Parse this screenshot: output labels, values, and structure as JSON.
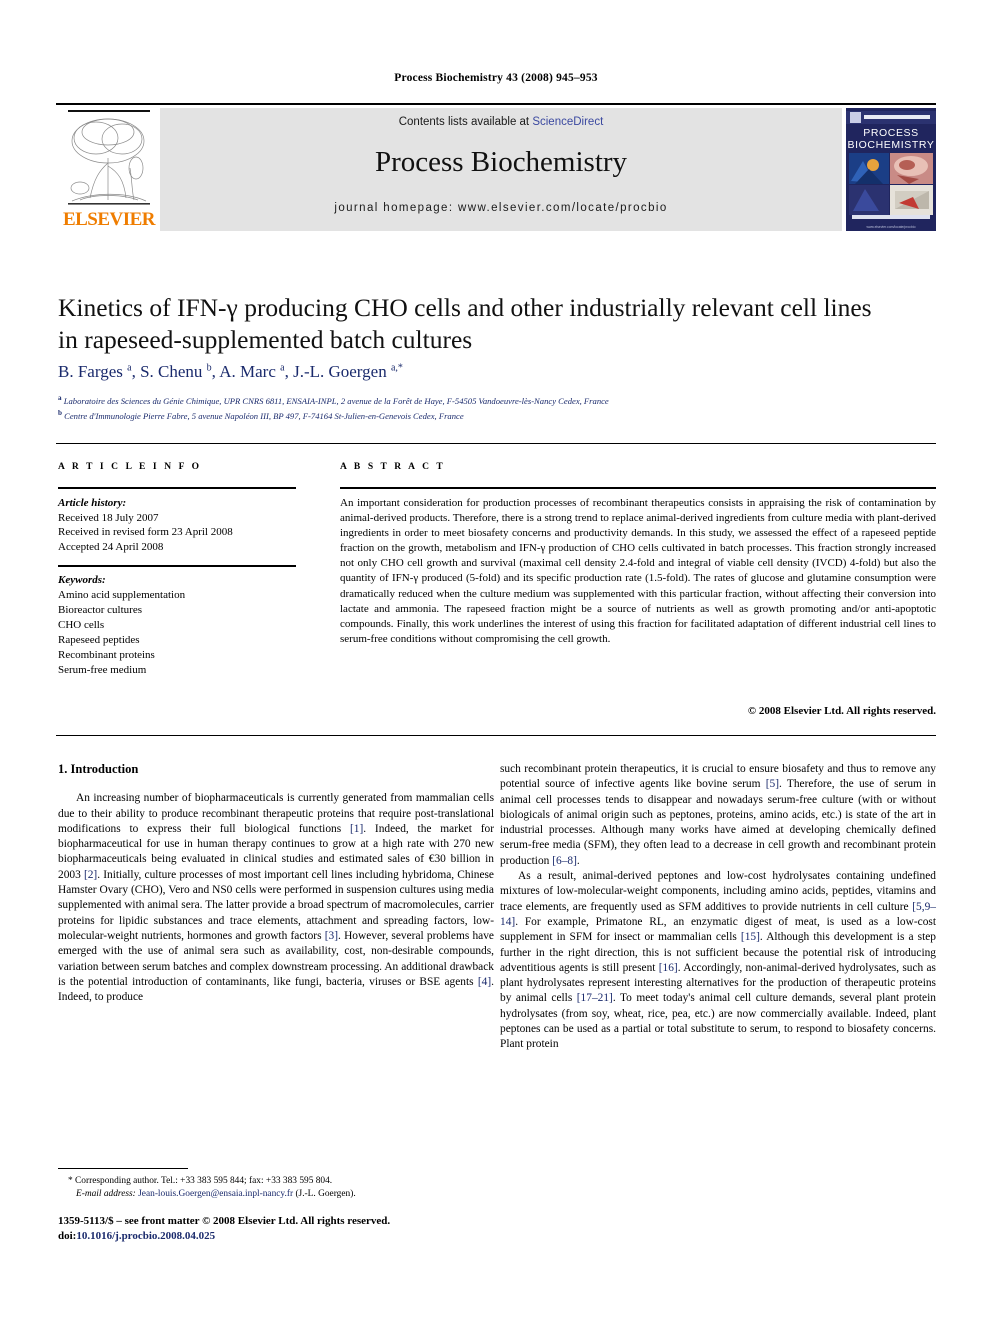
{
  "running_head": "Process Biochemistry 43 (2008) 945–953",
  "banner": {
    "contents_prefix": "Contents lists available at ",
    "sciencedirect": "ScienceDirect",
    "journal_title": "Process Biochemistry",
    "homepage": "journal homepage: www.elsevier.com/locate/procbio",
    "publisher_logo_text": "ELSEVIER",
    "cover_title_line1": "PROCESS",
    "cover_title_line2": "BIOCHEMISTRY",
    "cover_url": "www.elsevier.com/locate/procbio",
    "link_color": "#3b49a0",
    "logo_color": "#ef7d00",
    "banner_bg": "#e3e3e3",
    "cover_bg": "#20255e"
  },
  "article": {
    "title": "Kinetics of IFN-γ producing CHO cells and other industrially relevant cell lines in rapeseed-supplemented batch cultures",
    "authors_html": "B. Farges <sup>a</sup>, S. Chenu <sup>b</sup>, A. Marc <sup>a</sup>, J.-L. Goergen <sup>a,*</sup>",
    "affiliation_a": "Laboratoire des Sciences du Génie Chimique, UPR CNRS 6811, ENSAIA-INPL, 2 avenue de la Forêt de Haye, F-54505 Vandoeuvre-lès-Nancy Cedex, France",
    "affiliation_b": "Centre d'Immunologie Pierre Fabre, 5 avenue Napoléon III, BP 497, F-74164 St-Julien-en-Genevois Cedex, France",
    "author_color": "#1a2a6c"
  },
  "info": {
    "heading": "A R T I C L E   I N F O",
    "history_label": "Article history:",
    "history": [
      "Received 18 July 2007",
      "Received in revised form 23 April 2008",
      "Accepted 24 April 2008"
    ],
    "keywords_label": "Keywords:",
    "keywords": [
      "Amino acid supplementation",
      "Bioreactor cultures",
      "CHO cells",
      "Rapeseed peptides",
      "Recombinant proteins",
      "Serum-free medium"
    ]
  },
  "abstract": {
    "heading": "A B S T R A C T",
    "text": "An important consideration for production processes of recombinant therapeutics consists in appraising the risk of contamination by animal-derived products. Therefore, there is a strong trend to replace animal-derived ingredients from culture media with plant-derived ingredients in order to meet biosafety concerns and productivity demands. In this study, we assessed the effect of a rapeseed peptide fraction on the growth, metabolism and IFN-γ production of CHO cells cultivated in batch processes. This fraction strongly increased not only CHO cell growth and survival (maximal cell density 2.4-fold and integral of viable cell density (IVCD) 4-fold) but also the quantity of IFN-γ produced (5-fold) and its specific production rate (1.5-fold). The rates of glucose and glutamine consumption were dramatically reduced when the culture medium was supplemented with this particular fraction, without affecting their conversion into lactate and ammonia. The rapeseed fraction might be a source of nutrients as well as growth promoting and/or anti-apoptotic compounds. Finally, this work underlines the interest of using this fraction for facilitated adaptation of different industrial cell lines to serum-free conditions without compromising the cell growth.",
    "copyright": "© 2008 Elsevier Ltd. All rights reserved."
  },
  "body": {
    "section_heading": "1. Introduction",
    "left_paragraph_1_a": "An increasing number of biopharmaceuticals is currently generated from mammalian cells due to their ability to produce recombinant therapeutic proteins that require post-translational modifications to express their full biological functions ",
    "ref1": "[1]",
    "left_paragraph_1_b": ". Indeed, the market for biopharmaceutical for use in human therapy continues to grow at a high rate with 270 new biopharmaceuticals being evaluated in clinical studies and estimated sales of €30 billion in 2003 ",
    "ref2": "[2]",
    "left_paragraph_1_c": ". Initially, culture processes of most important cell lines including hybridoma, Chinese Hamster Ovary (CHO), Vero and NS0 cells were performed in suspension cultures using media supplemented with animal sera. The latter provide a broad spectrum of macromolecules, carrier proteins for lipidic substances and trace elements, attachment and spreading factors, low-molecular-weight nutrients, hormones and growth factors ",
    "ref3": "[3]",
    "left_paragraph_1_d": ". However, several problems have emerged with the use of animal sera such as availability, cost, non-desirable compounds, variation between serum batches and complex downstream processing. An additional drawback is the potential introduction of contaminants, like fungi, bacteria, viruses or BSE agents ",
    "ref4": "[4]",
    "left_paragraph_1_e": ". Indeed, to produce",
    "right_paragraph_1_a": "such recombinant protein therapeutics, it is crucial to ensure biosafety and thus to remove any potential source of infective agents like bovine serum ",
    "ref5": "[5]",
    "right_paragraph_1_b": ". Therefore, the use of serum in animal cell processes tends to disappear and nowadays serum-free culture (with or without biologicals of animal origin such as peptones, proteins, amino acids, etc.) is state of the art in industrial processes. Although many works have aimed at developing chemically defined serum-free media (SFM), they often lead to a decrease in cell growth and recombinant protein production ",
    "ref68": "[6–8]",
    "right_paragraph_1_c": ".",
    "right_paragraph_2_a": "As a result, animal-derived peptones and low-cost hydrolysates containing undefined mixtures of low-molecular-weight components, including amino acids, peptides, vitamins and trace elements, are frequently used as SFM additives to provide nutrients in cell culture ",
    "ref5914": "[5,9–14]",
    "right_paragraph_2_b": ". For example, Primatone RL, an enzymatic digest of meat, is used as a low-cost supplement in SFM for insect or mammalian cells ",
    "ref15": "[15]",
    "right_paragraph_2_c": ". Although this development is a step further in the right direction, this is not sufficient because the potential risk of introducing adventitious agents is still present ",
    "ref16": "[16]",
    "right_paragraph_2_d": ". Accordingly, non-animal-derived hydrolysates, such as plant hydrolysates represent interesting alternatives for the production of therapeutic proteins by animal cells ",
    "ref1721": "[17–21]",
    "right_paragraph_2_e": ". To meet today's animal cell culture demands, several plant protein hydrolysates (from soy, wheat, rice, pea, etc.) are now commercially available. Indeed, plant peptones can be used as a partial or total substitute to serum, to respond to biosafety concerns. Plant protein",
    "ref_color": "#1a2a6c"
  },
  "footer": {
    "corresponding_marker": "*",
    "corresponding_text": "Corresponding author. Tel.: +33 383 595 844; fax: +33 383 595 804.",
    "email_label": "E-mail address:",
    "email": "Jean-louis.Goergen@ensaia.inpl-nancy.fr",
    "email_suffix": "(J.-L. Goergen).",
    "issn_line": "1359-5113/$ – see front matter © 2008 Elsevier Ltd. All rights reserved.",
    "doi_label": "doi:",
    "doi_value": "10.1016/j.procbio.2008.04.025"
  }
}
